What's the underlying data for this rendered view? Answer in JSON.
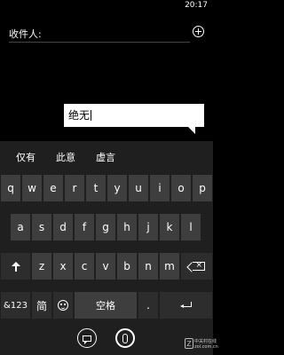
{
  "status_bar": {
    "time": "20:17"
  },
  "recipient": {
    "label": "收件人:",
    "add_icon": "add-circle-icon"
  },
  "compose": {
    "text": "绝无"
  },
  "suggestions": [
    "仅有",
    "此意",
    "虚言"
  ],
  "keyboard": {
    "row1": [
      "q",
      "w",
      "e",
      "r",
      "t",
      "y",
      "u",
      "i",
      "o",
      "p"
    ],
    "row2": [
      "a",
      "s",
      "d",
      "f",
      "g",
      "h",
      "j",
      "k",
      "l"
    ],
    "row3": [
      "z",
      "x",
      "c",
      "v",
      "b",
      "n",
      "m"
    ],
    "shift_icon": "shift-icon",
    "backspace_icon": "backspace-icon",
    "numbers_label": "&123",
    "lang_label": "简",
    "emoji_icon": "emoji-icon",
    "space_label": "空格",
    "period_label": ".",
    "enter_icon": "enter-icon"
  },
  "appbar": {
    "buttons": [
      "speech-bubble-icon",
      "attach-icon"
    ]
  },
  "watermark": {
    "logo": "Z",
    "line1": "中关村在线",
    "line2": "zol.com.cn"
  }
}
